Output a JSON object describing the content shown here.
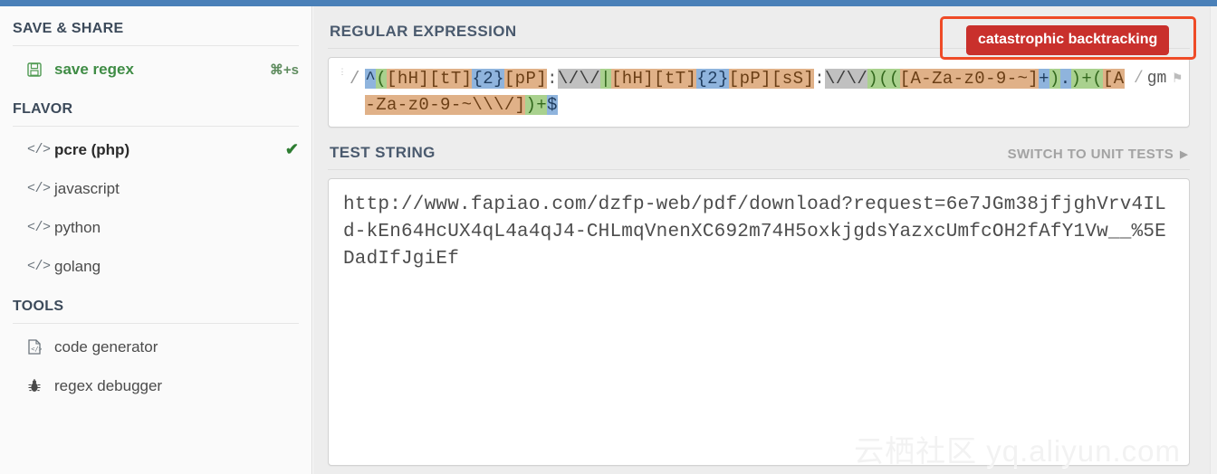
{
  "theme": {
    "topbar_color": "#4a80b8",
    "badge_color": "#c9302c",
    "annotation_color": "#ef4b27",
    "accent_green": "#3f8c45"
  },
  "sidebar": {
    "sections": [
      {
        "title": "SAVE & SHARE"
      },
      {
        "title": "FLAVOR"
      },
      {
        "title": "TOOLS"
      }
    ],
    "save_share": {
      "title": "SAVE & SHARE",
      "item": {
        "icon": "floppy-disk-icon",
        "label": "save regex",
        "shortcut": "⌘+s"
      }
    },
    "flavor": {
      "title": "FLAVOR",
      "items": [
        {
          "icon": "code-icon",
          "label": "pcre (php)",
          "selected": true,
          "check": "✔"
        },
        {
          "icon": "code-icon",
          "label": "javascript",
          "selected": false,
          "check": ""
        },
        {
          "icon": "code-icon",
          "label": "python",
          "selected": false,
          "check": ""
        },
        {
          "icon": "code-icon",
          "label": "golang",
          "selected": false,
          "check": ""
        }
      ]
    },
    "tools": {
      "title": "TOOLS",
      "items": [
        {
          "icon": "code-file-icon",
          "label": "code generator"
        },
        {
          "icon": "bug-icon",
          "label": "regex debugger"
        }
      ]
    }
  },
  "regex_panel": {
    "title": "REGULAR EXPRESSION",
    "grip_icon": "drag-handle-icon",
    "open_delimiter": "/",
    "close_delimiter": "/",
    "flags": "gm",
    "flag_icon": "flag-icon",
    "full_pattern": "^(([hH][tT]{2}[pP]:\\/\\/|[hH][tT]{2}[pP][sS]:\\/\\/)(([A-Za-z0-9-~]+).)+([A-Za-z0-9-~\\\\\\/])+$",
    "tokens": [
      {
        "text": "^",
        "type": "anchor"
      },
      {
        "text": "(",
        "type": "group"
      },
      {
        "text": "[hH]",
        "type": "class"
      },
      {
        "text": "[tT]",
        "type": "class"
      },
      {
        "text": "{2}",
        "type": "quant"
      },
      {
        "text": "[pP]",
        "type": "class"
      },
      {
        "text": ":",
        "type": "plain"
      },
      {
        "text": "\\/\\/",
        "type": "literal"
      },
      {
        "text": "|",
        "type": "group"
      },
      {
        "text": "[hH]",
        "type": "class"
      },
      {
        "text": "[tT]",
        "type": "class"
      },
      {
        "text": "{2}",
        "type": "quant"
      },
      {
        "text": "[pP]",
        "type": "class"
      },
      {
        "text": "[sS]",
        "type": "class"
      },
      {
        "text": ":",
        "type": "plain"
      },
      {
        "text": "\\/\\/",
        "type": "literal"
      },
      {
        "text": ")",
        "type": "group"
      },
      {
        "text": "((",
        "type": "group"
      },
      {
        "text": "[A-Za-z0-9-~]",
        "type": "class"
      },
      {
        "text": "+",
        "type": "quant"
      },
      {
        "text": ")",
        "type": "group"
      },
      {
        "text": ".",
        "type": "dot"
      },
      {
        "text": ")+",
        "type": "group"
      },
      {
        "text": "(",
        "type": "group"
      },
      {
        "text": "[A-Za-z0-9-~\\\\\\/]",
        "type": "class"
      },
      {
        "text": ")+",
        "type": "group"
      },
      {
        "text": "$",
        "type": "anchor"
      }
    ]
  },
  "warning": {
    "label": "catastrophic backtracking"
  },
  "test_panel": {
    "title": "TEST STRING",
    "action_label": "SWITCH TO UNIT TESTS",
    "action_arrow": "▶",
    "content": "http://www.fapiao.com/dzfp-web/pdf/download?request=6e7JGm38jfjghVrv4ILd-kEn64HcUX4qL4a4qJ4-CHLmqVnenXC692m74H5oxkjgdsYazxcUmfcOH2fAfY1Vw__%5EDadIfJgiEf"
  },
  "watermark": {
    "text": "云栖社区  yq.aliyun.com"
  }
}
